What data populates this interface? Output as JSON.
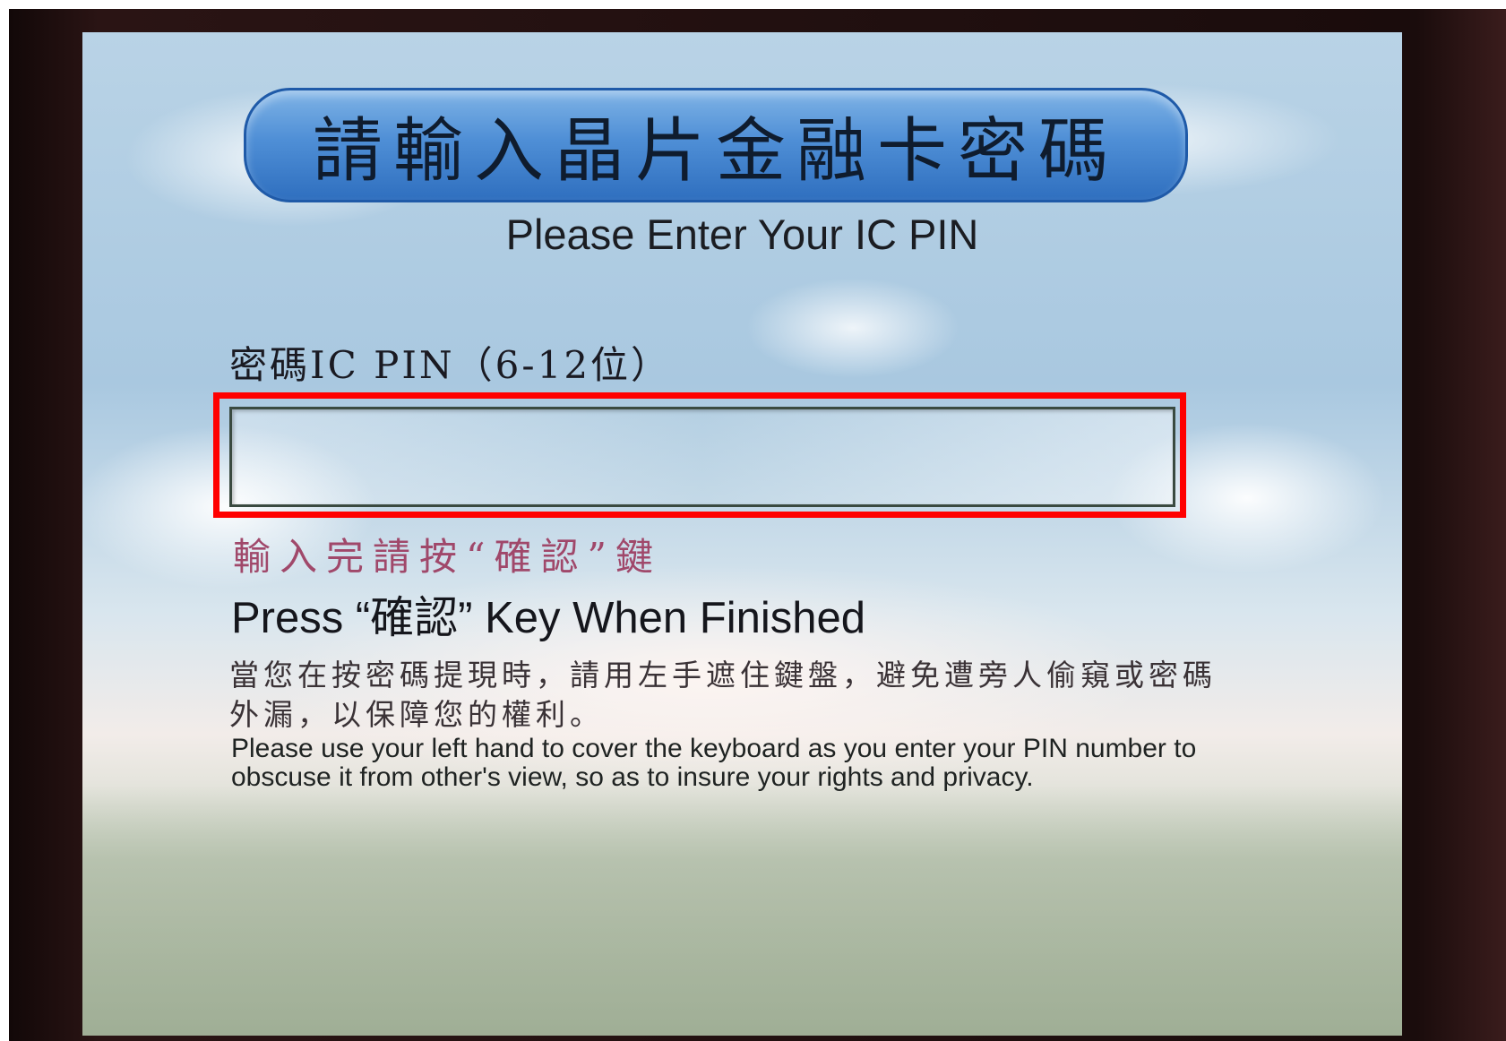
{
  "header": {
    "title_zh": "請輸入晶片金融卡密碼",
    "title_en": "Please Enter Your IC PIN"
  },
  "pin": {
    "label": "密碼IC PIN（6-12位）",
    "value": ""
  },
  "hint": {
    "zh": "輸入完請按“確認”鍵",
    "en": "Press “確認” Key When Finished"
  },
  "notice": {
    "zh": "當您在按密碼提現時，請用左手遮住鍵盤，避免遭旁人偷窺或密碼外漏，以保障您的權利。",
    "en": "Please use your left hand to cover the keyboard as you enter your PIN number to obscuse it from other's view, so as to insure your rights and privacy."
  },
  "colors": {
    "highlight": "#ff0000",
    "banner": "#4f8fd6",
    "hint_zh": "#a0486a"
  }
}
